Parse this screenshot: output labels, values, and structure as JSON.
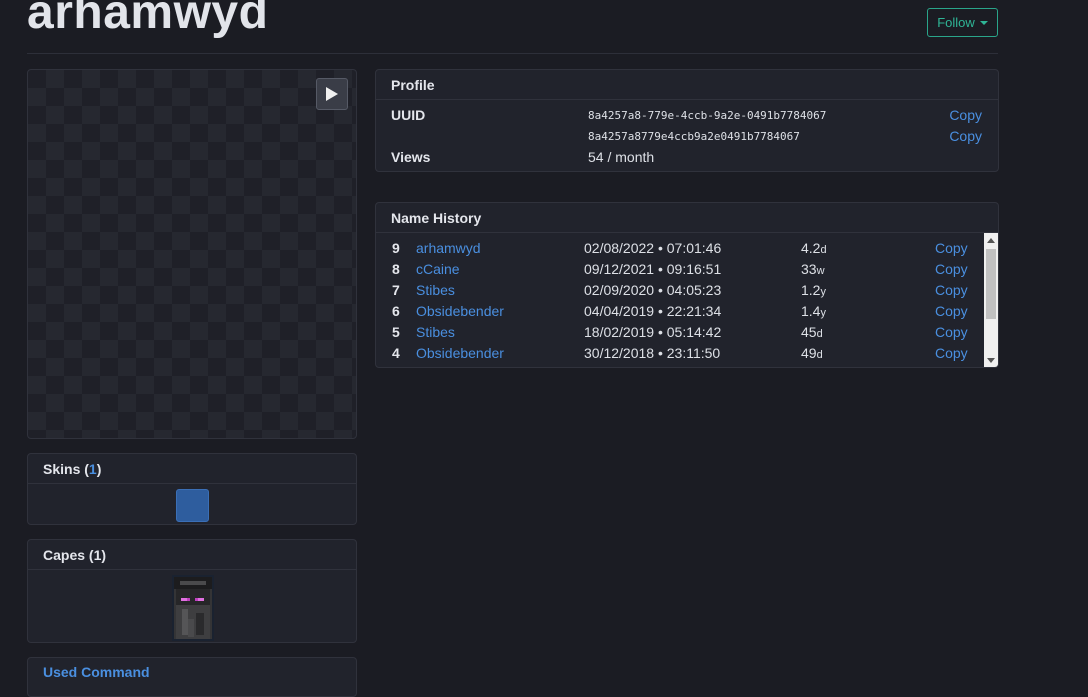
{
  "page": {
    "title": "arhamwyd",
    "follow_label": "Follow"
  },
  "skins": {
    "label": "Skins",
    "count_open": "(",
    "count": "1",
    "count_close": ")"
  },
  "capes": {
    "label": "Capes (1)"
  },
  "used_command": {
    "label": "Used Command"
  },
  "profile": {
    "header": "Profile",
    "uuid_label": "UUID",
    "uuid": "8a4257a8-779e-4ccb-9a2e-0491b7784067",
    "uuid_compact": "8a4257a8779e4ccb9a2e0491b7784067",
    "copy_label": "Copy",
    "views_label": "Views",
    "views_value": "54 / month"
  },
  "name_history": {
    "header": "Name History",
    "rows": [
      {
        "num": "9",
        "name": "arhamwyd",
        "date": "02/08/2022 • 07:01:46",
        "age": "4.2",
        "unit": "d",
        "copy": "Copy"
      },
      {
        "num": "8",
        "name": "cCaine",
        "date": "09/12/2021 • 09:16:51",
        "age": "33",
        "unit": "w",
        "copy": "Copy"
      },
      {
        "num": "7",
        "name": "Stibes",
        "date": "02/09/2020 • 04:05:23",
        "age": "1.2",
        "unit": "y",
        "copy": "Copy"
      },
      {
        "num": "6",
        "name": "Obsidebender",
        "date": "04/04/2019 • 22:21:34",
        "age": "1.4",
        "unit": "y",
        "copy": "Copy"
      },
      {
        "num": "5",
        "name": "Stibes",
        "date": "18/02/2019 • 05:14:42",
        "age": "45",
        "unit": "d",
        "copy": "Copy"
      },
      {
        "num": "4",
        "name": "Obsidebender",
        "date": "30/12/2018 • 23:11:50",
        "age": "49",
        "unit": "d",
        "copy": "Copy"
      }
    ]
  },
  "colors": {
    "accent": "#4a8fe0",
    "follow": "#2fb596",
    "background": "#1b1c23",
    "card": "#21232c"
  }
}
